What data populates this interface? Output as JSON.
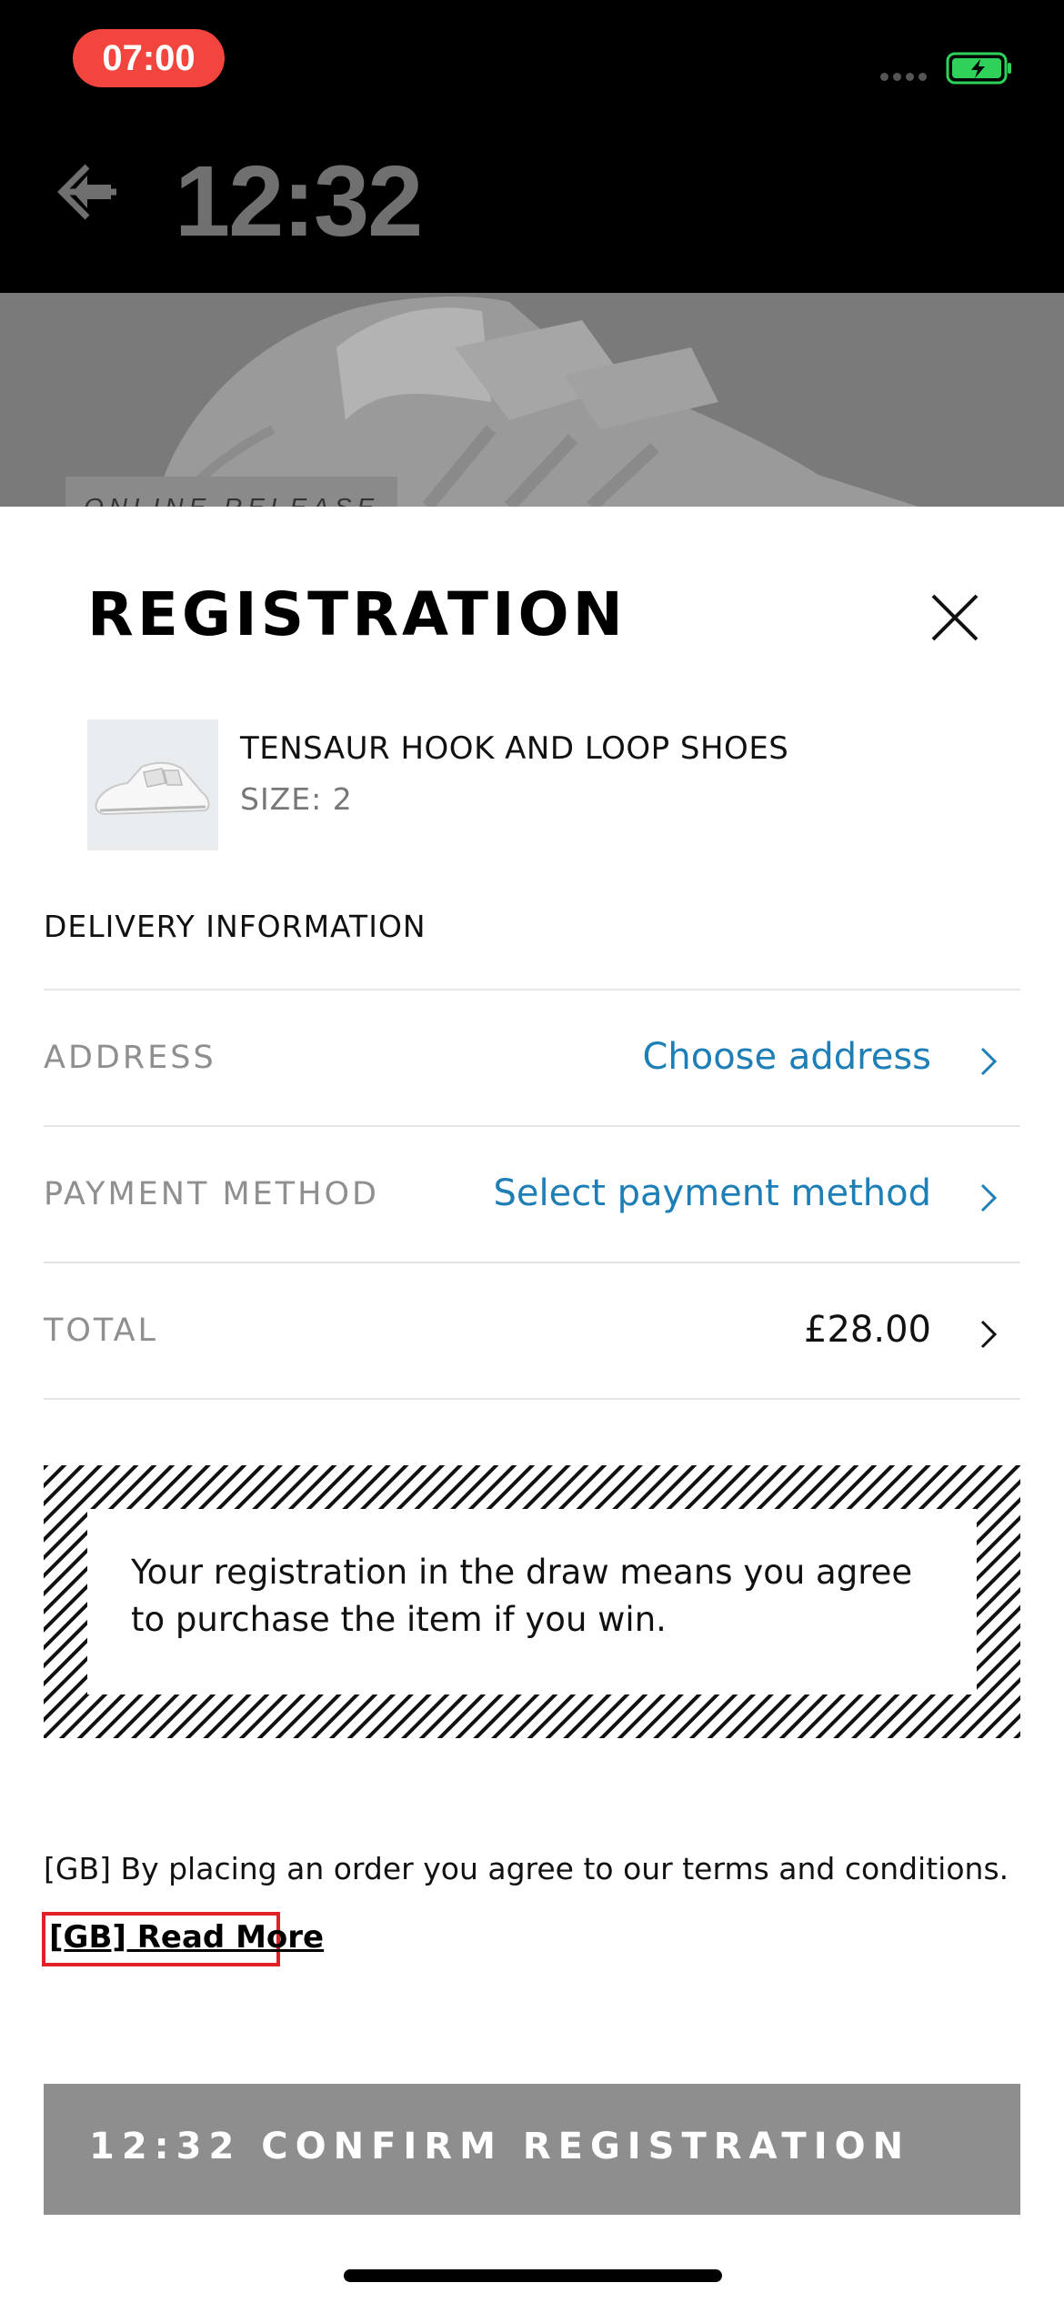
{
  "status_bar": {
    "time": "07:00",
    "battery_color": "#30d158"
  },
  "header": {
    "time": "12:32"
  },
  "hero": {
    "tag": "ONLINE RELEASE"
  },
  "modal": {
    "title": "REGISTRATION",
    "product": {
      "name": "TENSAUR HOOK AND LOOP SHOES",
      "size": "SIZE: 2"
    },
    "section_title": "DELIVERY INFORMATION",
    "rows": [
      {
        "label": "ADDRESS",
        "value": "Choose address"
      },
      {
        "label": "PAYMENT METHOD",
        "value": "Select payment method"
      },
      {
        "label": "TOTAL",
        "value": "£28.00"
      }
    ],
    "notice": "Your registration in the draw means you agree to purchase the item if you win.",
    "terms": "[GB] By placing an order you agree to our terms and conditions.",
    "read_more": "[GB] Read More",
    "confirm_button": "12:32 CONFIRM REGISTRATION"
  },
  "colors": {
    "link": "#1d7fb5",
    "highlight_box": "#e2202a",
    "status_pill": "#f2453d"
  }
}
